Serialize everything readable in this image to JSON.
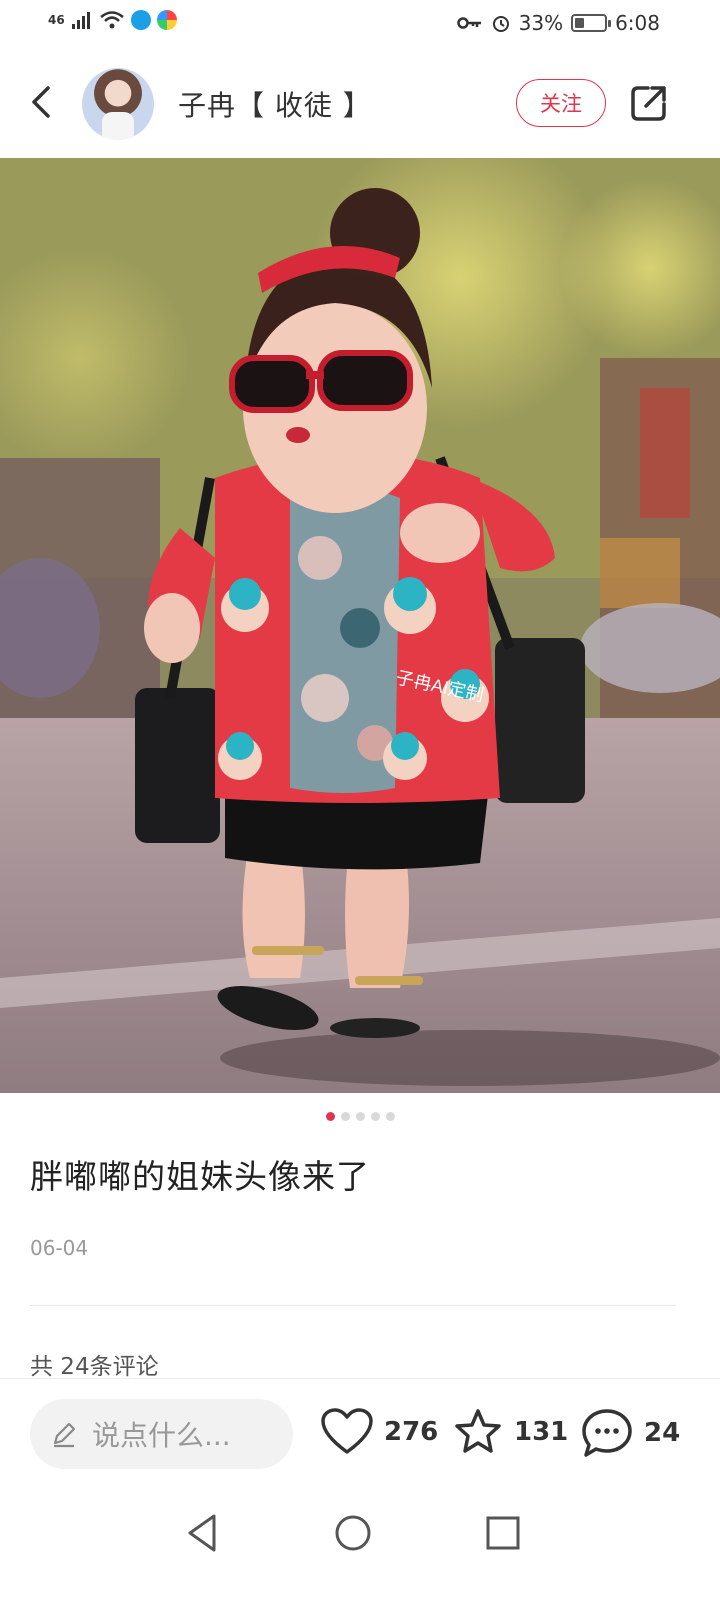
{
  "status_bar": {
    "network": "46",
    "battery": "33%",
    "battery_level": 0.33,
    "time": "6:08"
  },
  "header": {
    "username": "子冉【 收徒 】",
    "follow_label": "关注"
  },
  "gallery": {
    "image_count": 5,
    "active_index": 0
  },
  "post": {
    "title": "胖嘟嘟的姐妹头像来了",
    "date": "06-04",
    "comments_header": "共 24条评论"
  },
  "photo": {
    "overlay_text": "子冉AI定制"
  },
  "bottom_bar": {
    "comment_placeholder": "说点什么...",
    "likes": "276",
    "favorites": "131",
    "comments": "24"
  },
  "colors": {
    "accent": "#e0364d",
    "text": "#222222",
    "muted": "#999999"
  },
  "icons": [
    "back-icon",
    "share-icon",
    "edit-icon",
    "heart-icon",
    "star-icon",
    "comment-icon",
    "nav-back-icon",
    "nav-home-icon",
    "nav-recents-icon"
  ]
}
